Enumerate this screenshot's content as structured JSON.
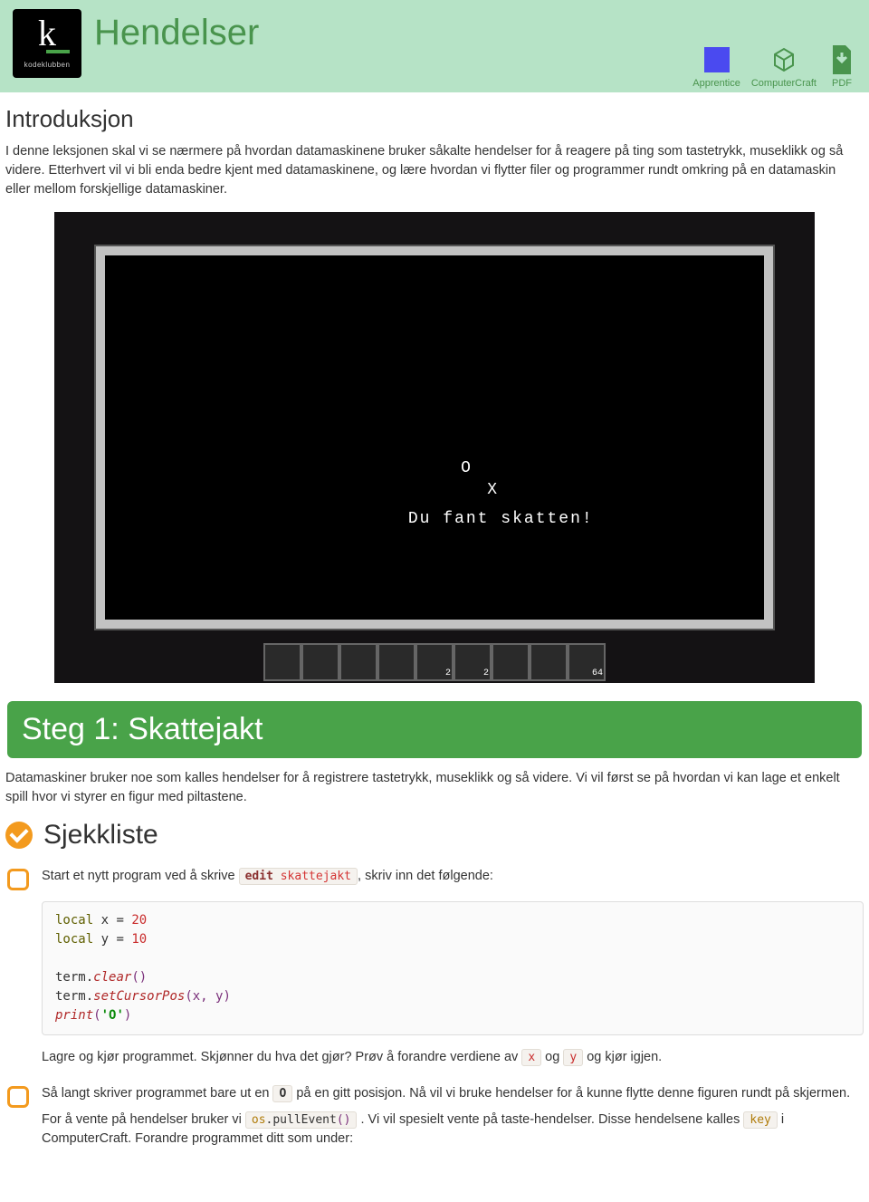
{
  "header": {
    "logo_letter": "k",
    "logo_text": "kodeklubben",
    "title": "Hendelser",
    "tags": {
      "apprentice": "Apprentice",
      "cc": "ComputerCraft",
      "pdf": "PDF"
    }
  },
  "intro": {
    "heading": "Introduksjon",
    "p1": "I denne leksjonen skal vi se nærmere på hvordan datamaskinene bruker såkalte hendelser for å reagere på ting som tastetrykk, museklikk og så videre. Etterhvert vil vi bli enda bedre kjent med datamaskinene, og lære hvordan vi flytter filer og programmer rundt omkring på en datamaskin eller mellom forskjellige datamaskiner."
  },
  "screenshot": {
    "o": "O",
    "x": "X",
    "msg": "Du fant skatten!",
    "slot_nums": [
      "",
      "",
      "",
      "",
      "2",
      "2",
      "",
      "",
      "64"
    ]
  },
  "step1": {
    "title": "Steg 1: Skattejakt",
    "lead": "Datamaskiner bruker noe som kalles hendelser for å registrere tastetrykk, museklikk og så videre. Vi vil først se på hvordan vi kan lage et enkelt spill hvor vi styrer en figur med piltastene."
  },
  "checklist": {
    "heading": "Sjekkliste",
    "item1_pre": "Start et nytt program ved å skrive ",
    "item1_cmd_b": "edit",
    "item1_cmd_r": "skattejakt",
    "item1_post": ", skriv inn det følgende:",
    "after_code_pre": "Lagre og kjør programmet. Skjønner du hva det gjør? Prøv å forandre verdiene av ",
    "after_code_x": "x",
    "after_code_mid": " og ",
    "after_code_y": "y",
    "after_code_post": " og kjør igjen.",
    "item2_a": "Så langt skriver programmet bare ut en ",
    "item2_O": "O",
    "item2_b": " på en gitt posisjon. Nå vil vi bruke hendelser for å kunne flytte denne figuren rundt på skjermen.",
    "item2_c_pre": "For å vente på hendelser bruker vi ",
    "item2_os": "os",
    "item2_dot": ".",
    "item2_pe": "pullEvent",
    "item2_paren": "()",
    "item2_c_post": ". Vi vil spesielt vente på taste-hendelser. Disse hendelsene kalles ",
    "item2_key": "key",
    "item2_c_tail": " i ComputerCraft. Forandre programmet ditt som under:"
  },
  "code1": {
    "l1_a": "local",
    "l1_b": " x = ",
    "l1_c": "20",
    "l2_a": "local",
    "l2_b": " y = ",
    "l2_c": "10",
    "l4_a": "term.",
    "l4_b": "clear",
    "l4_c": "()",
    "l5_a": "term.",
    "l5_b": "setCursorPos",
    "l5_c": "(x, y)",
    "l6_a": "print",
    "l6_b": "(",
    "l6_c": "'O'",
    "l6_d": ")"
  }
}
